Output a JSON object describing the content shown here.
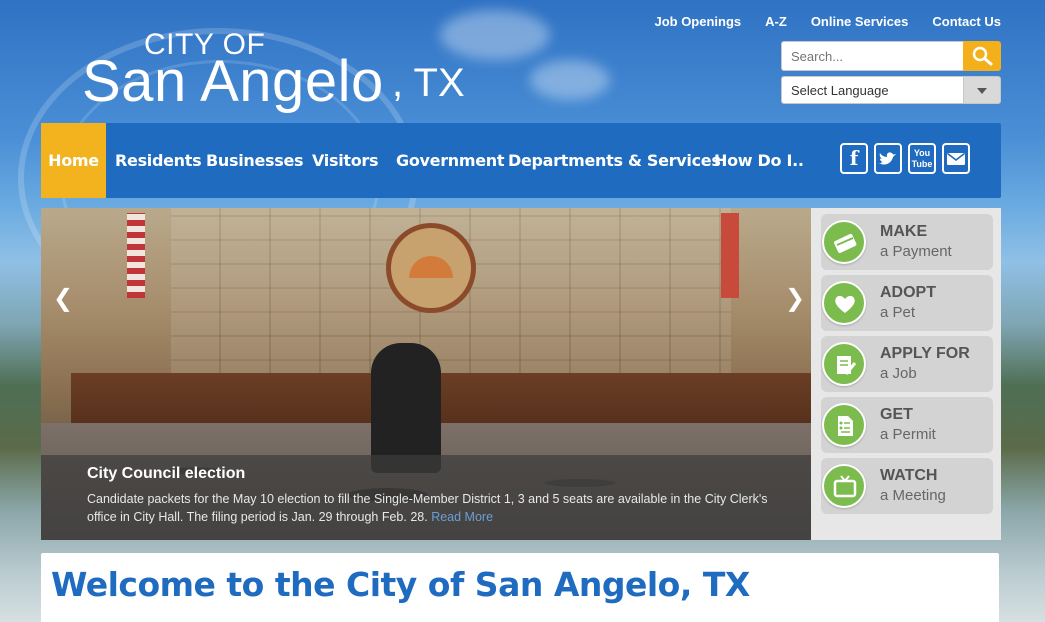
{
  "header": {
    "logo_line1": "CITY OF",
    "logo_line2": "San Angelo",
    "logo_line3": ", TX",
    "top_links": [
      "Job Openings",
      "A-Z",
      "Online Services",
      "Contact Us"
    ],
    "search_placeholder": "Search...",
    "language_label": "Select Language"
  },
  "nav": {
    "items": [
      "Home",
      "Residents",
      "Businesses",
      "Visitors",
      "Government",
      "Departments & Services",
      "How Do I.."
    ],
    "social": [
      {
        "label": "f",
        "icon": "facebook-icon"
      },
      {
        "label": "t",
        "icon": "twitter-icon"
      },
      {
        "label": "You Tube",
        "icon": "youtube-icon"
      },
      {
        "label": "",
        "icon": "email-icon"
      }
    ]
  },
  "slider": {
    "title": "City Council election",
    "description": "Candidate packets for the May 10 election to fill the Single-Member District 1, 3 and 5 seats are available in the City Clerk's office in City Hall. The filing period is Jan. 29 through Feb. 28.",
    "read_more": "Read More",
    "prev": "❮",
    "next": "❯"
  },
  "quick_links": [
    {
      "big": "MAKE",
      "small": "a Payment",
      "icon": "payment-card-icon"
    },
    {
      "big": "ADOPT",
      "small": "a Pet",
      "icon": "pet-heart-icon"
    },
    {
      "big": "APPLY FOR",
      "small": "a Job",
      "icon": "job-application-icon"
    },
    {
      "big": "GET",
      "small": "a Permit",
      "icon": "permit-document-icon"
    },
    {
      "big": "WATCH",
      "small": "a Meeting",
      "icon": "tv-icon"
    }
  ],
  "welcome": {
    "heading": "Welcome to the City of San Angelo, TX"
  },
  "colors": {
    "nav_blue": "#1f6bbf",
    "accent_yellow": "#f3b31f",
    "quick_green": "#7cbb4d"
  }
}
